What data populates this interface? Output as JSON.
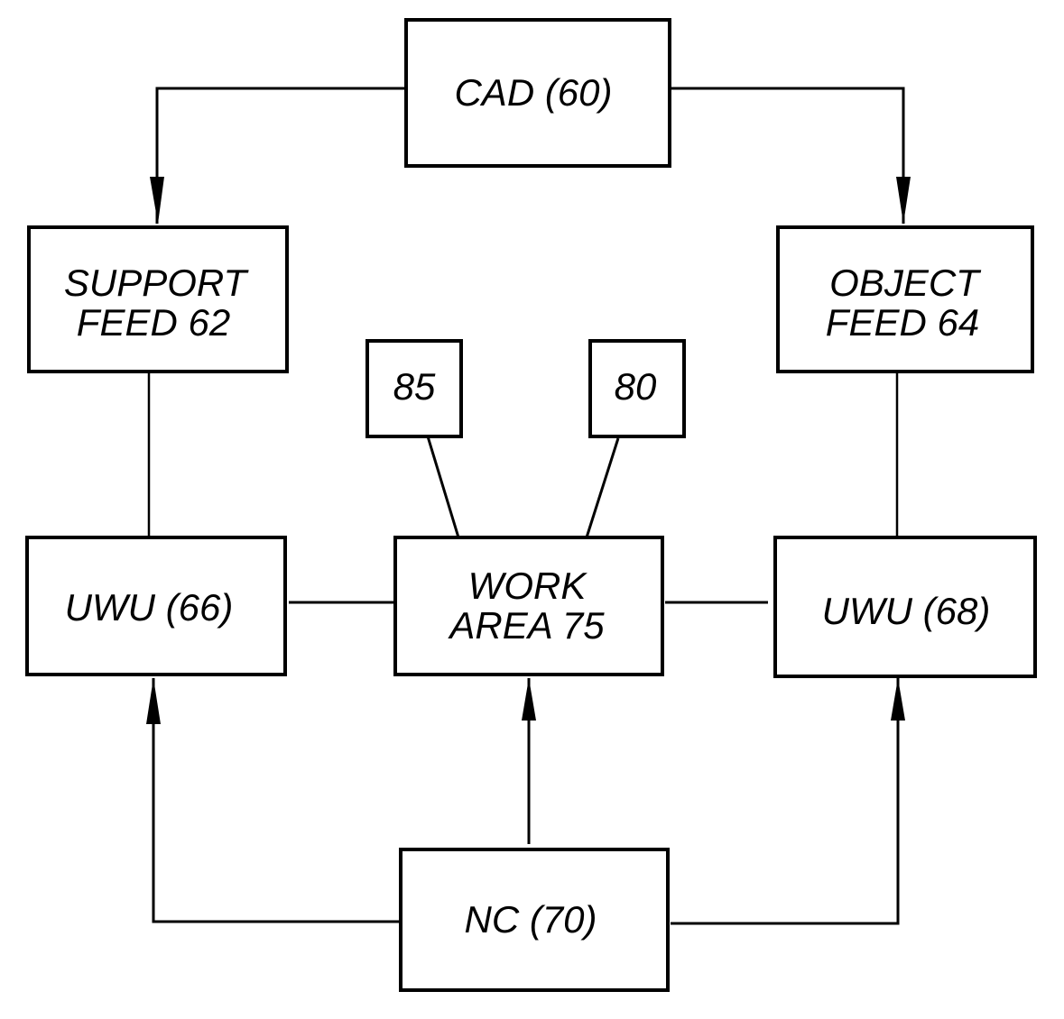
{
  "diagram": {
    "nodes": {
      "cad": {
        "lines": [
          "CAD (60)"
        ]
      },
      "support_feed": {
        "lines": [
          "SUPPORT",
          "FEED 62"
        ]
      },
      "object_feed": {
        "lines": [
          "OBJECT",
          "FEED 64"
        ]
      },
      "box85": {
        "lines": [
          "85"
        ]
      },
      "box80": {
        "lines": [
          "80"
        ]
      },
      "uwu66": {
        "lines": [
          "UWU (66)"
        ]
      },
      "work_area": {
        "lines": [
          "WORK",
          "AREA 75"
        ]
      },
      "uwu68": {
        "lines": [
          "UWU (68)"
        ]
      },
      "nc": {
        "lines": [
          "NC (70)"
        ]
      }
    },
    "edges": [
      {
        "from": "cad",
        "to": "support_feed",
        "arrow": true
      },
      {
        "from": "cad",
        "to": "object_feed",
        "arrow": true
      },
      {
        "from": "support_feed",
        "to": "uwu66",
        "arrow": false
      },
      {
        "from": "object_feed",
        "to": "uwu68",
        "arrow": false
      },
      {
        "from": "box85",
        "to": "work_area",
        "arrow": false
      },
      {
        "from": "box80",
        "to": "work_area",
        "arrow": false
      },
      {
        "from": "uwu66",
        "to": "work_area",
        "arrow": false
      },
      {
        "from": "work_area",
        "to": "uwu68",
        "arrow": false
      },
      {
        "from": "nc",
        "to": "uwu66",
        "arrow": true
      },
      {
        "from": "nc",
        "to": "work_area",
        "arrow": true
      },
      {
        "from": "nc",
        "to": "uwu68",
        "arrow": true
      }
    ]
  }
}
